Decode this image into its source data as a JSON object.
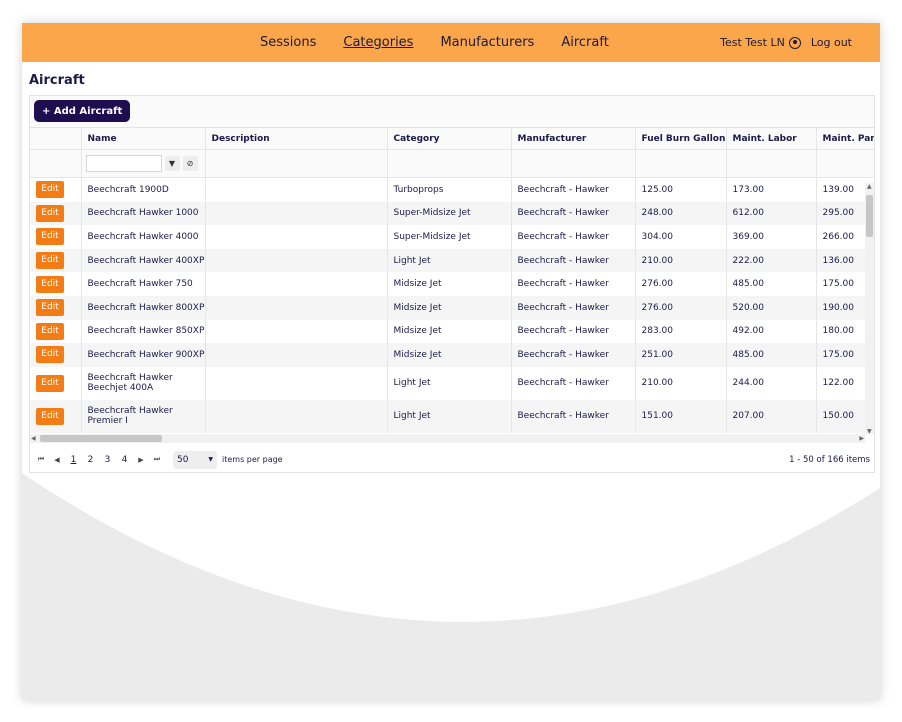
{
  "nav": {
    "links": [
      "Sessions",
      "Categories",
      "Manufacturers",
      "Aircraft"
    ],
    "active_index": 1
  },
  "user": {
    "name": "Test Test LN",
    "logout": "Log out"
  },
  "page": {
    "title": "Aircraft"
  },
  "toolbar": {
    "add_label": "+ Add Aircraft"
  },
  "table": {
    "columns": [
      "",
      "Name",
      "Description",
      "Category",
      "Manufacturer",
      "Fuel Burn Gallon...",
      "Maint. Labor",
      "Maint. Par"
    ],
    "edit_label": "Edit",
    "rows": [
      {
        "name": "Beechcraft 1900D",
        "description": "",
        "category": "Turboprops",
        "manufacturer": "Beechcraft - Hawker",
        "fuel": "125.00",
        "labor": "173.00",
        "parts": "139.00"
      },
      {
        "name": "Beechcraft Hawker 1000",
        "description": "",
        "category": "Super-Midsize Jet",
        "manufacturer": "Beechcraft - Hawker",
        "fuel": "248.00",
        "labor": "612.00",
        "parts": "295.00"
      },
      {
        "name": "Beechcraft Hawker 4000",
        "description": "",
        "category": "Super-Midsize Jet",
        "manufacturer": "Beechcraft - Hawker",
        "fuel": "304.00",
        "labor": "369.00",
        "parts": "266.00"
      },
      {
        "name": "Beechcraft Hawker 400XP",
        "description": "",
        "category": "Light Jet",
        "manufacturer": "Beechcraft - Hawker",
        "fuel": "210.00",
        "labor": "222.00",
        "parts": "136.00"
      },
      {
        "name": "Beechcraft Hawker 750",
        "description": "",
        "category": "Midsize Jet",
        "manufacturer": "Beechcraft - Hawker",
        "fuel": "276.00",
        "labor": "485.00",
        "parts": "175.00"
      },
      {
        "name": "Beechcraft Hawker 800XP",
        "description": "",
        "category": "Midsize Jet",
        "manufacturer": "Beechcraft - Hawker",
        "fuel": "276.00",
        "labor": "520.00",
        "parts": "190.00"
      },
      {
        "name": "Beechcraft Hawker 850XP",
        "description": "",
        "category": "Midsize Jet",
        "manufacturer": "Beechcraft - Hawker",
        "fuel": "283.00",
        "labor": "492.00",
        "parts": "180.00"
      },
      {
        "name": "Beechcraft Hawker 900XP",
        "description": "",
        "category": "Midsize Jet",
        "manufacturer": "Beechcraft - Hawker",
        "fuel": "251.00",
        "labor": "485.00",
        "parts": "175.00"
      },
      {
        "name": "Beechcraft Hawker Beechjet 400A",
        "description": "",
        "category": "Light Jet",
        "manufacturer": "Beechcraft - Hawker",
        "fuel": "210.00",
        "labor": "244.00",
        "parts": "122.00"
      },
      {
        "name": "Beechcraft Hawker Premier I",
        "description": "",
        "category": "Light Jet",
        "manufacturer": "Beechcraft - Hawker",
        "fuel": "151.00",
        "labor": "207.00",
        "parts": "150.00"
      }
    ]
  },
  "pager": {
    "pages": [
      "1",
      "2",
      "3",
      "4"
    ],
    "current": "1",
    "page_size": "50",
    "items_per_page": "items per page",
    "range": "1 - 50 of 166 items"
  },
  "icons": {
    "user": "user-circle-icon",
    "filter": "filter-icon",
    "clear_filter": "filter-clear-icon",
    "first": "first-page-icon",
    "prev": "prev-page-icon",
    "next": "next-page-icon",
    "last": "last-page-icon",
    "dropdown": "chevron-down-icon"
  },
  "colors": {
    "topbar": "#fba64a",
    "primary": "#1e0e4f",
    "edit": "#f47c14",
    "text": "#1b1b4a"
  }
}
